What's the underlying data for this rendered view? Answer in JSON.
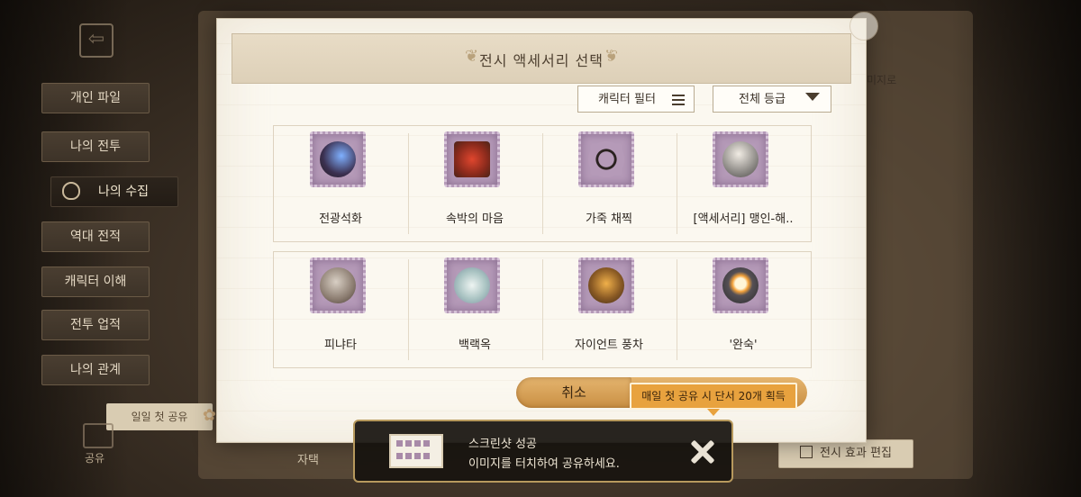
{
  "modal": {
    "title": "전시 액세서리 선택",
    "filter_label": "캐릭터 필터",
    "grade_label": "전체 등급",
    "cancel_label": "취소",
    "reward_badge": "매일 첫 공유 시 단서 20개 획득"
  },
  "items": [
    {
      "name": "전광석화",
      "icon": "lightning-gauntlet-icon"
    },
    {
      "name": "속박의 마음",
      "icon": "bound-heart-icon"
    },
    {
      "name": "가죽 채찍",
      "icon": "leather-whip-icon"
    },
    {
      "name": "[액세서리] 맹인-해..",
      "icon": "chalice-icon"
    },
    {
      "name": "피냐타",
      "icon": "pinata-icon"
    },
    {
      "name": "백랙옥",
      "icon": "jade-creature-icon"
    },
    {
      "name": "자이언트 풍차",
      "icon": "giant-windmill-icon"
    },
    {
      "name": "'완숙'",
      "icon": "fried-egg-pan-icon"
    }
  ],
  "sidebar": {
    "items": [
      {
        "label": "개인 파일"
      },
      {
        "label": "나의 전투"
      },
      {
        "label": "나의 수집"
      },
      {
        "label": "역대 전적"
      },
      {
        "label": "캐릭터 이해"
      },
      {
        "label": "전투 업적"
      },
      {
        "label": "나의 관계"
      }
    ]
  },
  "background": {
    "daily_share_label": "일일 첫 공유",
    "share_label": "공유",
    "self_desc_label": "자택",
    "right_partial_text": "미지로",
    "effect_edit_label": "전시 효과 편집"
  },
  "toast": {
    "line1": "스크린샷 성공",
    "line2": "이미지를 터치하여 공유하세요."
  }
}
